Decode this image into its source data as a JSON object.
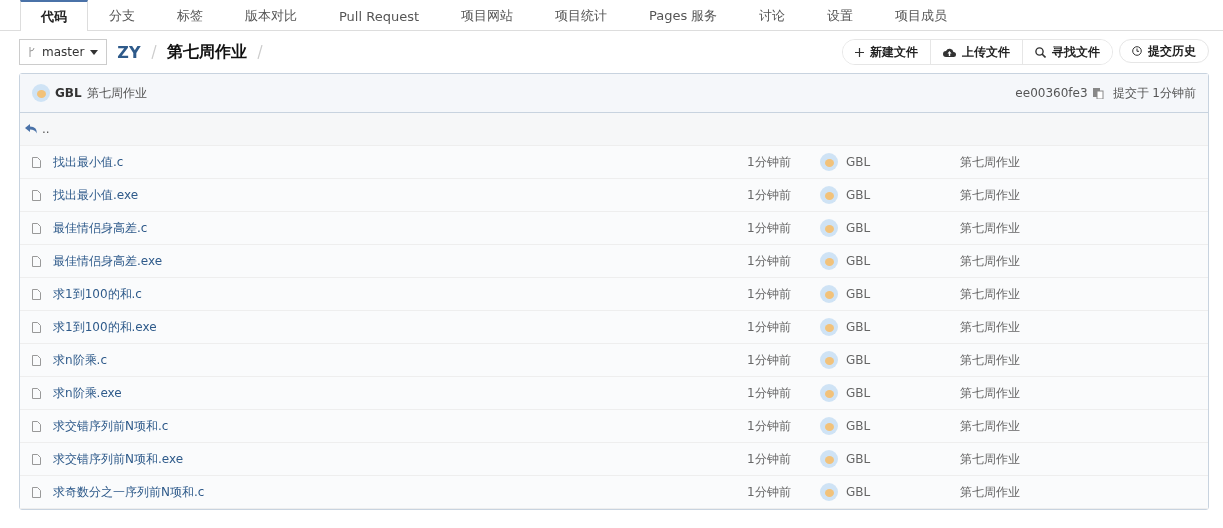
{
  "tabs": [
    {
      "label": "代码",
      "selected": true
    },
    {
      "label": "分支",
      "selected": false
    },
    {
      "label": "标签",
      "selected": false
    },
    {
      "label": "版本对比",
      "selected": false
    },
    {
      "label": "Pull Request",
      "selected": false
    },
    {
      "label": "项目网站",
      "selected": false
    },
    {
      "label": "项目统计",
      "selected": false
    },
    {
      "label": "Pages 服务",
      "selected": false
    },
    {
      "label": "讨论",
      "selected": false
    },
    {
      "label": "设置",
      "selected": false
    },
    {
      "label": "项目成员",
      "selected": false
    }
  ],
  "branch": "master",
  "breadcrumb": [
    "ZY",
    "第七周作业"
  ],
  "actions": [
    "新建文件",
    "上传文件",
    "寻找文件"
  ],
  "history_button": "提交历史",
  "commit": {
    "author": "GBL",
    "message": "第七周作业",
    "hash": "ee00360fe3",
    "time": "提交于 1分钟前"
  },
  "parent_link": "..",
  "files": [
    {
      "name": "找出最小值.c",
      "time": "1分钟前",
      "author": "GBL",
      "message": "第七周作业"
    },
    {
      "name": "找出最小值.exe",
      "time": "1分钟前",
      "author": "GBL",
      "message": "第七周作业"
    },
    {
      "name": "最佳情侣身高差.c",
      "time": "1分钟前",
      "author": "GBL",
      "message": "第七周作业"
    },
    {
      "name": "最佳情侣身高差.exe",
      "time": "1分钟前",
      "author": "GBL",
      "message": "第七周作业"
    },
    {
      "name": "求1到100的和.c",
      "time": "1分钟前",
      "author": "GBL",
      "message": "第七周作业"
    },
    {
      "name": "求1到100的和.exe",
      "time": "1分钟前",
      "author": "GBL",
      "message": "第七周作业"
    },
    {
      "name": "求n阶乘.c",
      "time": "1分钟前",
      "author": "GBL",
      "message": "第七周作业"
    },
    {
      "name": "求n阶乘.exe",
      "time": "1分钟前",
      "author": "GBL",
      "message": "第七周作业"
    },
    {
      "name": "求交错序列前N项和.c",
      "time": "1分钟前",
      "author": "GBL",
      "message": "第七周作业"
    },
    {
      "name": "求交错序列前N项和.exe",
      "time": "1分钟前",
      "author": "GBL",
      "message": "第七周作业"
    },
    {
      "name": "求奇数分之一序列前N项和.c",
      "time": "1分钟前",
      "author": "GBL",
      "message": "第七周作业"
    }
  ]
}
